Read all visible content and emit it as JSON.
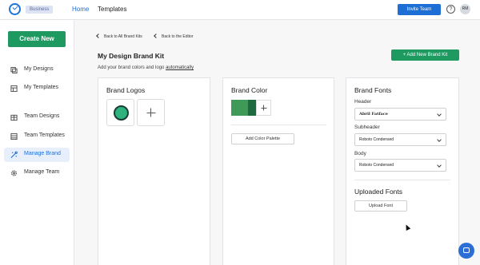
{
  "topbar": {
    "plan_badge": "Business",
    "nav_home": "Home",
    "nav_templates": "Templates",
    "invite_button": "Invite Team",
    "help_symbol": "?",
    "avatar_initials": "RM"
  },
  "sidebar": {
    "create_button": "Create New",
    "items": [
      {
        "label": "My Designs",
        "icon": "designs-icon"
      },
      {
        "label": "My Templates",
        "icon": "templates-icon"
      },
      {
        "label": "Team Designs",
        "icon": "team-designs-icon"
      },
      {
        "label": "Team Templates",
        "icon": "team-templates-icon"
      },
      {
        "label": "Manage Brand",
        "icon": "brand-icon",
        "active": true
      },
      {
        "label": "Manage Team",
        "icon": "gear-icon"
      }
    ]
  },
  "main": {
    "back_all_kits": "Back to All Brand Kits",
    "back_editor": "Back to the Editor",
    "title": "My Design Brand Kit",
    "subtitle_prefix": "Add your brand colors and logo ",
    "subtitle_link": "automatically",
    "add_kit_button": "+ Add New Brand Kit"
  },
  "logos_panel": {
    "title": "Brand Logos"
  },
  "color_panel": {
    "title": "Brand Color",
    "swatches": [
      "#3f9a57",
      "#1e6b3f"
    ],
    "add_palette_button": "Add Color Palette"
  },
  "fonts_panel": {
    "title": "Brand Fonts",
    "header_label": "Header",
    "header_value": "Abril Fatface",
    "subheader_label": "Subheader",
    "subheader_value": "Roboto Condensed",
    "body_label": "Body",
    "body_value": "Roboto Condensed",
    "uploaded_title": "Uploaded Fonts",
    "upload_button": "Upload Font"
  },
  "colors": {
    "accent_blue": "#1d6fd6",
    "accent_green": "#1e9a61"
  }
}
